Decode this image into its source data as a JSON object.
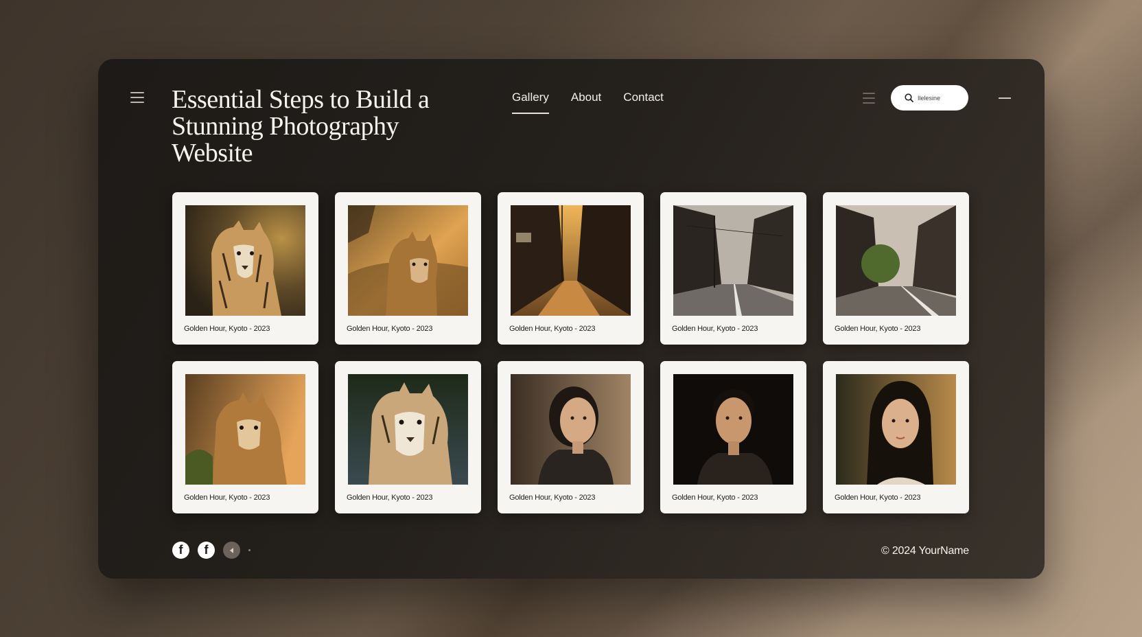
{
  "header": {
    "title": "Essential Steps to Build a Stunning Photography Website",
    "nav": [
      {
        "label": "Gallery",
        "active": true
      },
      {
        "label": "About",
        "active": false
      },
      {
        "label": "Contact",
        "active": false
      }
    ],
    "search_placeholder": "Ilelesine"
  },
  "gallery": {
    "items": [
      {
        "caption": "Golden Hour, Kyoto - 2023",
        "subject": "tiger"
      },
      {
        "caption": "Golden Hour, Kyoto - 2023",
        "subject": "lioness"
      },
      {
        "caption": "Golden Hour, Kyoto - 2023",
        "subject": "street-sunset"
      },
      {
        "caption": "Golden Hour, Kyoto - 2023",
        "subject": "street"
      },
      {
        "caption": "Golden Hour, Kyoto - 2023",
        "subject": "street-tree"
      },
      {
        "caption": "Golden Hour, Kyoto - 2023",
        "subject": "lioness"
      },
      {
        "caption": "Golden Hour, Kyoto - 2023",
        "subject": "tiger-close"
      },
      {
        "caption": "Golden Hour, Kyoto - 2023",
        "subject": "portrait-woman"
      },
      {
        "caption": "Golden Hour, Kyoto - 2023",
        "subject": "portrait-man"
      },
      {
        "caption": "Golden Hour, Kyoto - 2023",
        "subject": "portrait-woman"
      }
    ]
  },
  "footer": {
    "social": [
      "facebook-icon",
      "facebook-icon",
      "share-icon"
    ],
    "copyright": "© 2024 YourName"
  },
  "colors": {
    "panel": "#24201c",
    "card": "#f7f5f2",
    "text_light": "#f6f2ec"
  }
}
